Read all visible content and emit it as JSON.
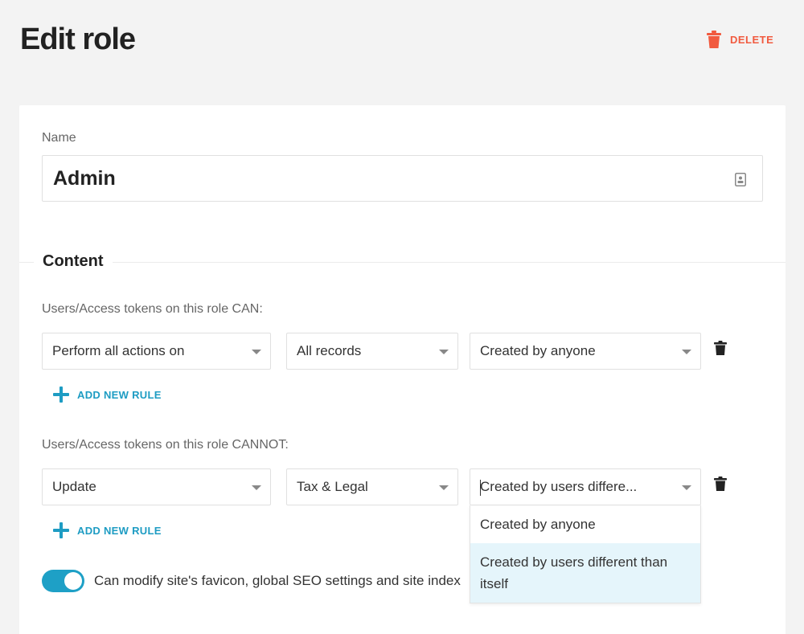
{
  "header": {
    "title": "Edit role",
    "delete_label": "DELETE"
  },
  "name_field": {
    "label": "Name",
    "value": "Admin"
  },
  "content_section": {
    "title": "Content",
    "can": {
      "heading": "Users/Access tokens on this role CAN:",
      "rule": {
        "action": "Perform all actions on",
        "model": "All records",
        "scope": "Created by anyone"
      },
      "add_rule_label": "ADD NEW RULE"
    },
    "cannot": {
      "heading": "Users/Access tokens on this role CANNOT:",
      "rule": {
        "action": "Update",
        "model": "Tax & Legal",
        "scope": "Created by users differe..."
      },
      "add_rule_label": "ADD NEW RULE",
      "scope_options": [
        "Created by anyone",
        "Created by users different than itself"
      ]
    },
    "favicon_toggle": {
      "label": "Can modify site's favicon, global SEO settings and site index",
      "enabled": true
    }
  },
  "colors": {
    "accent": "#1ea0c6",
    "danger": "#f15a3f",
    "selected_option": "#e5f5fb"
  }
}
